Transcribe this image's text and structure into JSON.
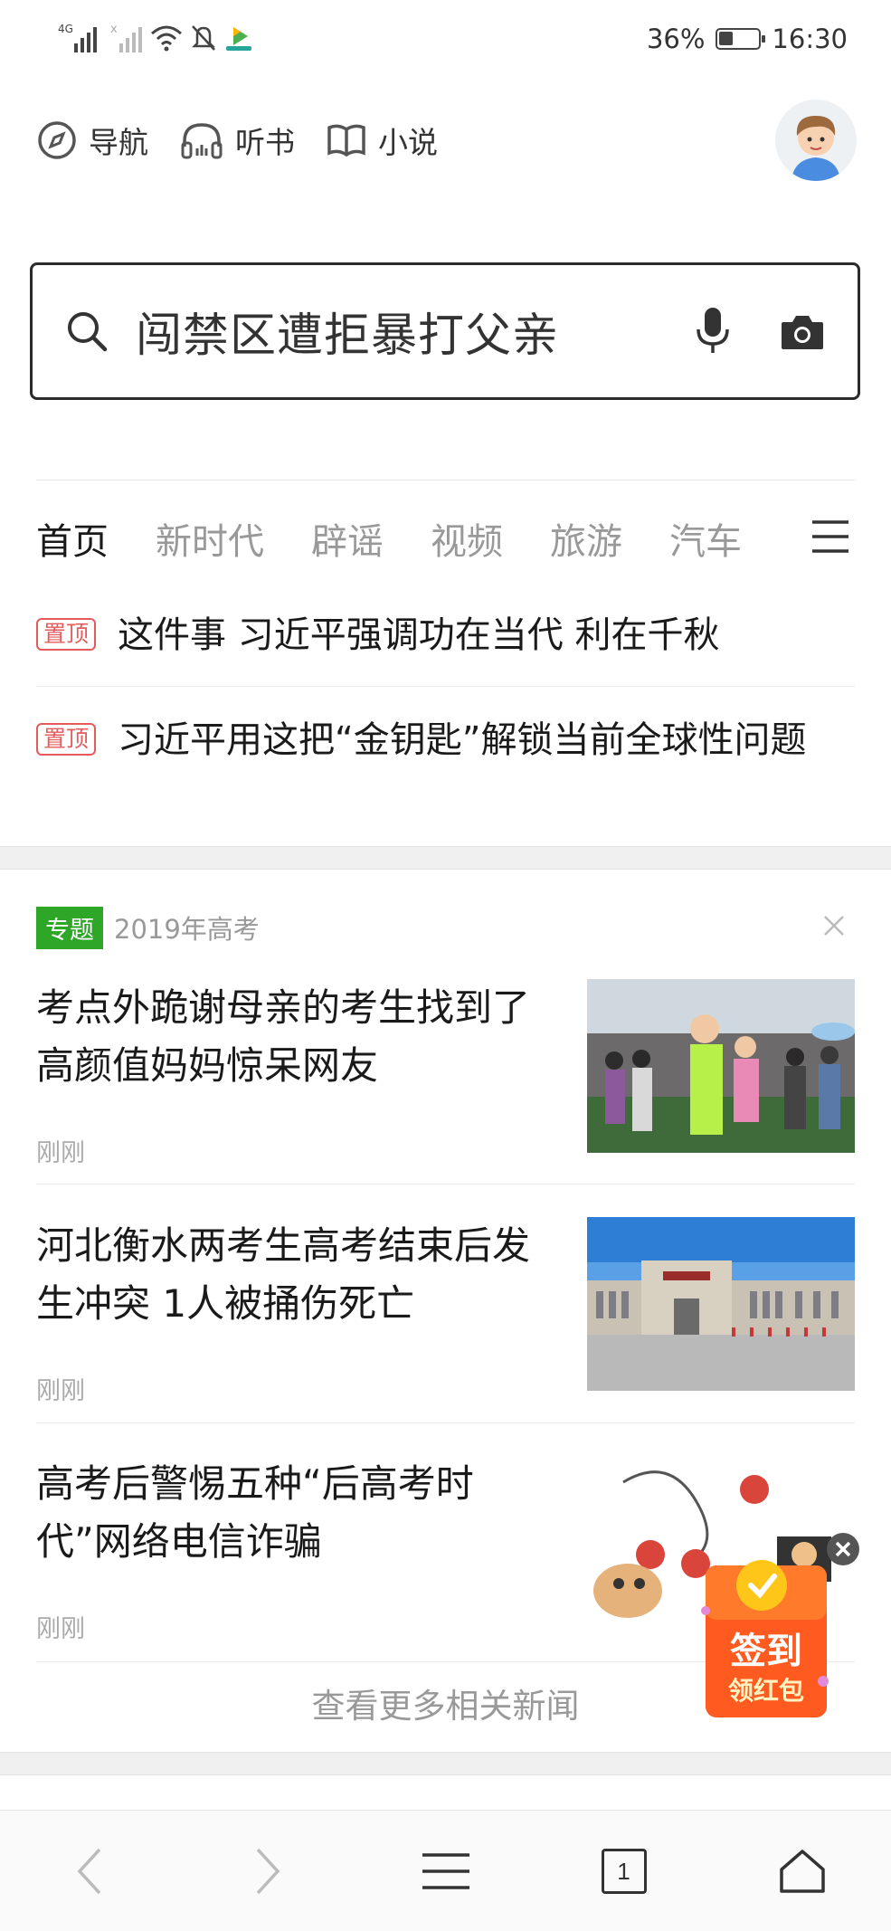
{
  "status_bar": {
    "network": "4G",
    "battery_percent": "36%",
    "battery_level": 0.36,
    "time": "16:30"
  },
  "top_nav": {
    "items": [
      {
        "label": "导航",
        "icon": "compass-icon"
      },
      {
        "label": "听书",
        "icon": "headphones-icon"
      },
      {
        "label": "小说",
        "icon": "book-icon"
      }
    ]
  },
  "search": {
    "text": "闯禁区遭拒暴打父亲"
  },
  "tabs": {
    "items": [
      "首页",
      "新时代",
      "辟谣",
      "视频",
      "旅游",
      "汽车"
    ],
    "active_index": 0
  },
  "pinned": {
    "badge": "置顶",
    "items": [
      "这件事 习近平强调功在当代 利在千秋",
      "习近平用这把“金钥匙”解锁当前全球性问题"
    ]
  },
  "topic": {
    "tag": "专题",
    "title": "2019年高考",
    "accent": "#2ea628"
  },
  "news": [
    {
      "title": "考点外跪谢母亲的考生找到了高颜值妈妈惊呆网友",
      "time": "刚刚",
      "thumb": "exam-crowd-photo"
    },
    {
      "title": "河北衡水两考生高考结束后发生冲突 1人被捅伤死亡",
      "time": "刚刚",
      "thumb": "school-building-photo"
    },
    {
      "title": "高考后警惕五种“后高考时代”网络电信诈骗",
      "time": "刚刚",
      "thumb": "fraud-cartoon-illustration"
    }
  ],
  "more_link": "查看更多相关新闻",
  "signin_badge": {
    "line1": "签到",
    "line2": "领红包"
  },
  "bottom_bar": {
    "tab_count": "1"
  }
}
